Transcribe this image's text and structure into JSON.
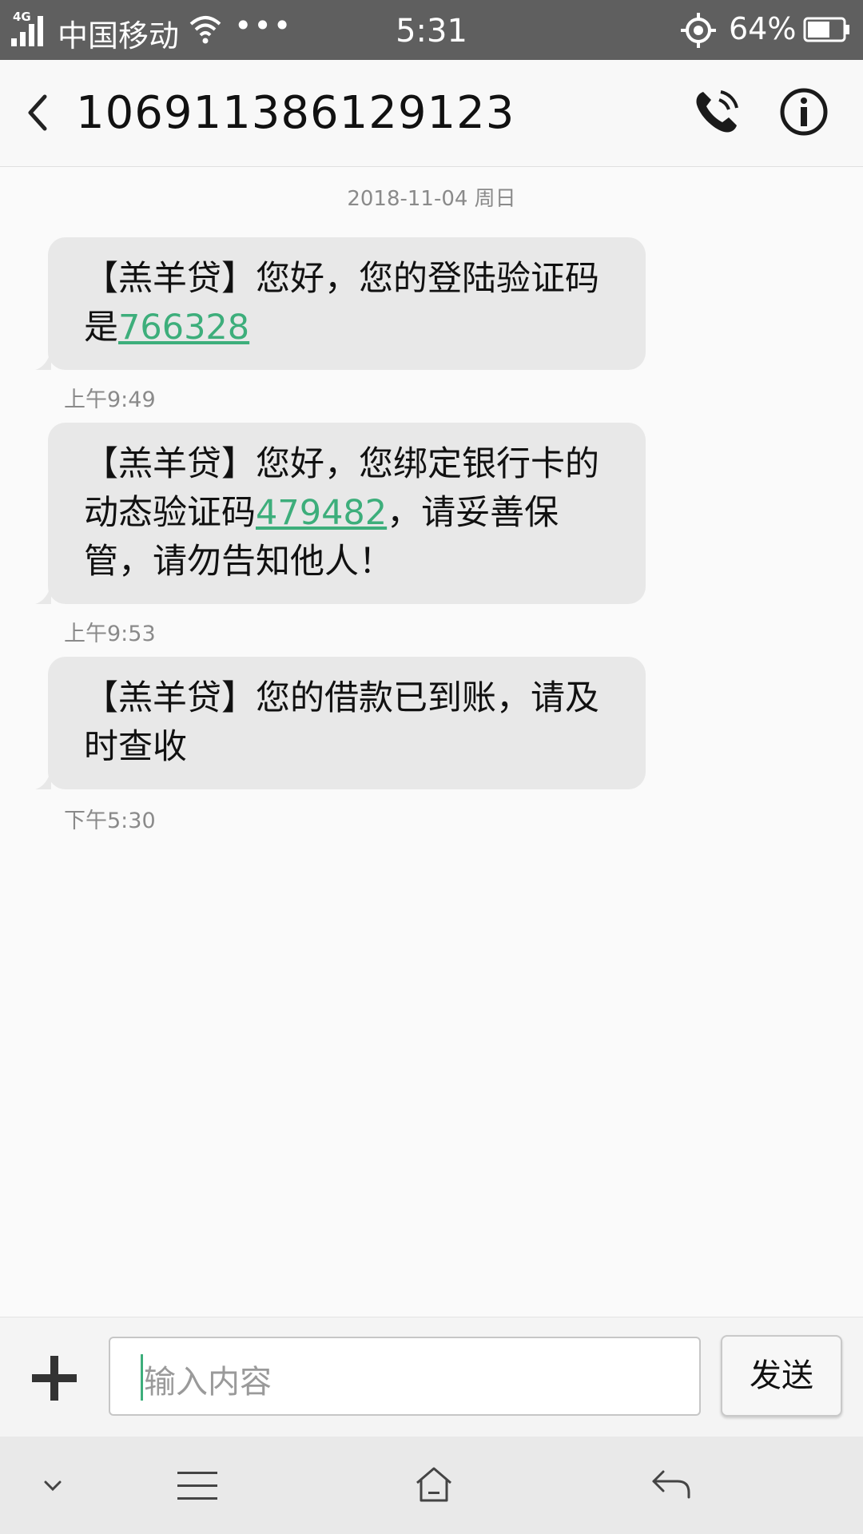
{
  "status_bar": {
    "network": "4G",
    "carrier": "中国移动",
    "more": "•••",
    "time": "5:31",
    "battery": "64%",
    "battery_level": 0.64
  },
  "header": {
    "title": "106911386129123",
    "back_icon": "chevron-left-icon",
    "call_icon": "phone-call-icon",
    "info_icon": "info-icon"
  },
  "conversation": {
    "date": "2018-11-04 周日",
    "messages": [
      {
        "pre": "【羔羊贷】您好，您的登陆验证码是",
        "code": "766328",
        "post": "",
        "time": "上午9:49"
      },
      {
        "pre": "【羔羊贷】您好，您绑定银行卡的动态验证码",
        "code": "479482",
        "post": "，请妥善保管，请勿告知他人！",
        "time": "上午9:53"
      },
      {
        "pre": "【羔羊贷】您的借款已到账，请及时查收",
        "code": "",
        "post": "",
        "time": "下午5:30"
      }
    ]
  },
  "composer": {
    "placeholder": "输入内容",
    "send_label": "发送",
    "add_icon": "plus-icon"
  },
  "nav_bar": {
    "icons": [
      "chevron-down-icon",
      "menu-icon",
      "home-icon",
      "back-icon"
    ]
  },
  "colors": {
    "status_bar": "#5f5f5f",
    "bubble": "#e8e8e8",
    "link": "#3dae7b"
  }
}
